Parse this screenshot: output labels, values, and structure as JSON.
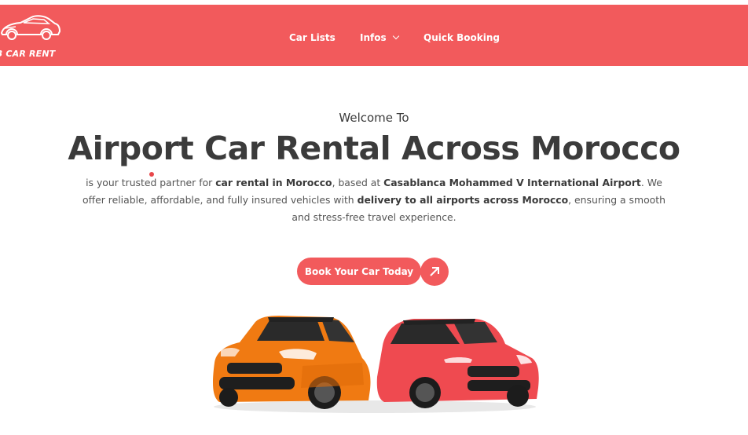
{
  "header": {
    "logo_text": "AB CAR RENT",
    "nav": [
      {
        "label": "Car Lists"
      },
      {
        "label": "Infos",
        "has_dropdown": true
      },
      {
        "label": "Quick Booking"
      }
    ]
  },
  "hero": {
    "welcome": "Welcome To",
    "title": "Airport Car Rental Across Morocco",
    "description": {
      "p1": "is your trusted partner for ",
      "b1": "car rental in Morocco",
      "p2": ", based at ",
      "b2": "Casablanca Mohammed V International Airport",
      "p3": ". We offer reliable, affordable, and fully insured vehicles with ",
      "b3": "delivery to all airports across Morocco",
      "p4": ", ensuring a smooth and stress-free travel experience."
    },
    "cta_label": "Book Your Car Today"
  },
  "colors": {
    "brand": "#f25a5c",
    "text_dark": "#3b3b3b",
    "car_left": "#f07a12",
    "car_right": "#ef4a50"
  }
}
